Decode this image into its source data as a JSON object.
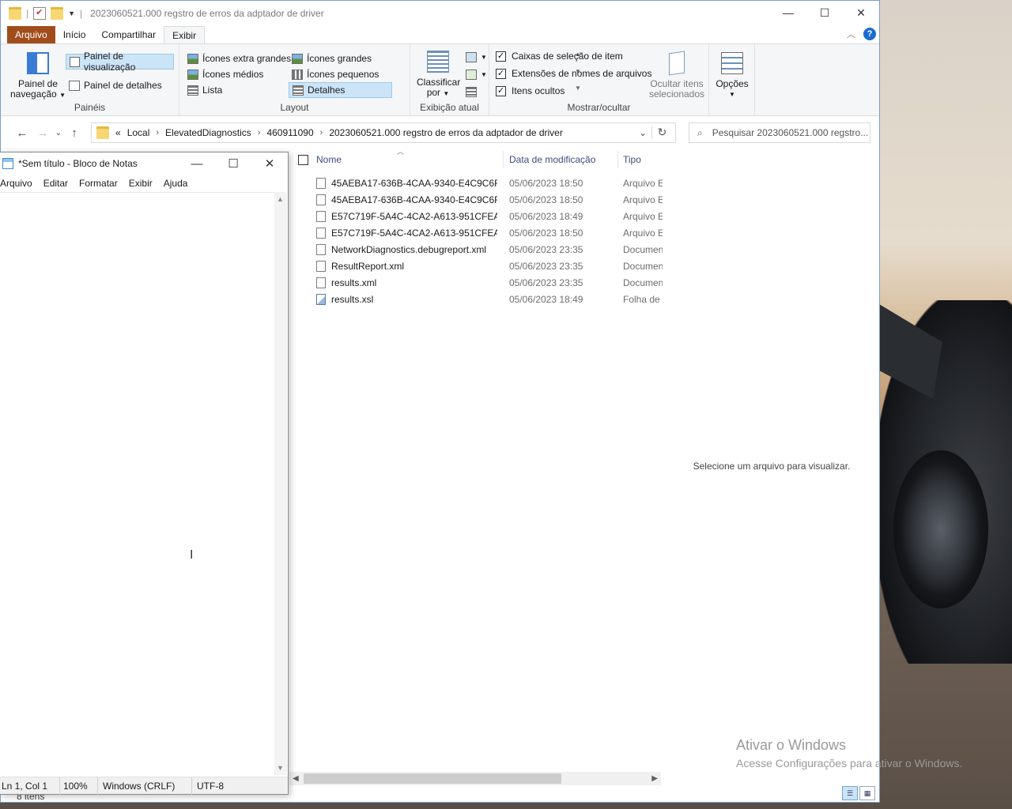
{
  "explorer": {
    "title": "2023060521.000  regstro de erros da adptador de driver",
    "tabs": [
      "Arquivo",
      "Início",
      "Compartilhar",
      "Exibir"
    ],
    "ribbon": {
      "panes": {
        "nav_pane_line1": "Painel de",
        "nav_pane_line2": "navegação",
        "preview_pane": "Painel de visualização",
        "details_pane": "Painel de detalhes",
        "label": "Painéis"
      },
      "layout": {
        "extra_large": "Ícones extra grandes",
        "large": "Ícones grandes",
        "medium": "Ícones médios",
        "small": "Ícones pequenos",
        "list": "Lista",
        "details": "Detalhes",
        "label": "Layout"
      },
      "current_view": {
        "sort_line1": "Classificar",
        "sort_line2": "por",
        "label": "Exibição atual"
      },
      "show_hide": {
        "item_checkboxes": "Caixas de seleção de item",
        "file_extensions": "Extensões de nomes de arquivos",
        "hidden_items": "Itens ocultos",
        "hide_selected_line1": "Ocultar itens",
        "hide_selected_line2": "selecionados",
        "label": "Mostrar/ocultar"
      },
      "options": "Opções"
    },
    "breadcrumb": [
      "Local",
      "ElevatedDiagnostics",
      "460911090",
      "2023060521.000  regstro de erros da adptador de driver"
    ],
    "breadcrumb_overflow": "«",
    "search_placeholder": "Pesquisar 2023060521.000  regstro...",
    "columns": {
      "name": "Nome",
      "date": "Data de modificação",
      "type": "Tipo"
    },
    "files": [
      {
        "name": "45AEBA17-636B-4CAA-9340-E4C9C6F...",
        "date": "05/06/2023 18:50",
        "type": "Arquivo ETL"
      },
      {
        "name": "45AEBA17-636B-4CAA-9340-E4C9C6F...",
        "date": "05/06/2023 18:50",
        "type": "Arquivo ETL"
      },
      {
        "name": "E57C719F-5A4C-4CA2-A613-951CFEA...",
        "date": "05/06/2023 18:49",
        "type": "Arquivo ETL"
      },
      {
        "name": "E57C719F-5A4C-4CA2-A613-951CFEA...",
        "date": "05/06/2023 18:50",
        "type": "Arquivo ETL"
      },
      {
        "name": "NetworkDiagnostics.debugreport.xml",
        "date": "05/06/2023 23:35",
        "type": "Documento XML"
      },
      {
        "name": "ResultReport.xml",
        "date": "05/06/2023 23:35",
        "type": "Documento XML"
      },
      {
        "name": "results.xml",
        "date": "05/06/2023 23:35",
        "type": "Documento XML"
      },
      {
        "name": "results.xsl",
        "date": "05/06/2023 18:49",
        "type": "Folha de estilos"
      }
    ],
    "preview_message": "Selecione um arquivo para visualizar.",
    "status_items": "8 itens"
  },
  "activation": {
    "title": "Ativar o Windows",
    "subtitle": "Acesse Configurações para ativar o Windows."
  },
  "notepad": {
    "title": "*Sem título - Bloco de Notas",
    "menu": [
      "Arquivo",
      "Editar",
      "Formatar",
      "Exibir",
      "Ajuda"
    ],
    "status": {
      "position": "Ln 1, Col 1",
      "zoom": "100%",
      "line_ending": "Windows (CRLF)",
      "encoding": "UTF-8"
    }
  }
}
